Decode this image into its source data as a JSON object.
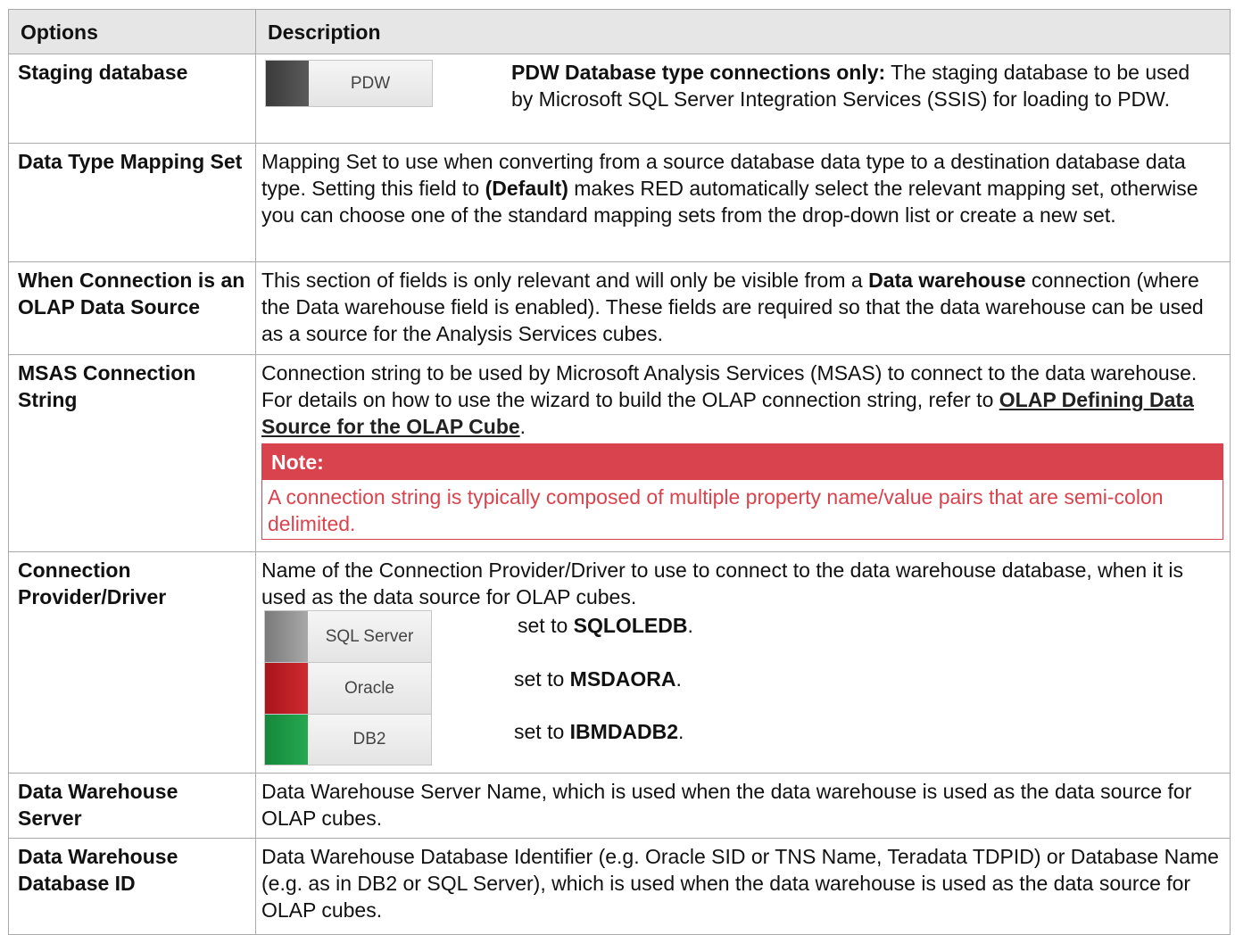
{
  "header": {
    "options": "Options",
    "description": "Description"
  },
  "rows": {
    "staging": {
      "option": "Staging database",
      "button_label": "PDW",
      "lead_bold": "PDW Database type connections only:",
      "text": " The staging database to be used by Microsoft SQL Server Integration Services (SSIS) for loading to PDW."
    },
    "mapping": {
      "option": "Data Type Mapping Set",
      "t1": " Mapping Set to use when converting from a source database data type to a destination database data type. Setting this field to ",
      "bold": "(Default)",
      "t2": " makes RED automatically select the relevant mapping set, otherwise you can choose one of the standard mapping sets from the drop-down list or create a new set."
    },
    "olap": {
      "option": "When Connection is an OLAP Data Source",
      "t1": " This section of fields is only relevant and will only be visible from a ",
      "bold": "Data warehouse",
      "t2": " connection (where the Data warehouse field is enabled). These fields are required so that the data warehouse can be used as a source for the Analysis Services cubes."
    },
    "msas": {
      "option": "MSAS Connection String",
      "t1": " Connection string to be used by Microsoft Analysis Services (MSAS) to connect to the data warehouse. For details on how to use the wizard to build the OLAP connection string, refer to ",
      "link": "OLAP Defining Data Source for the OLAP Cube",
      "t2": ".",
      "note_title": "Note:",
      "note_text": " A connection string is typically composed of multiple property name/value pairs that are semi-colon delimited."
    },
    "provider": {
      "option": "Connection Provider/Driver",
      "text": " Name of the Connection Provider/Driver to use to connect to the data warehouse database, when it is used as the data source for OLAP cubes.",
      "drivers": [
        {
          "label": "SQL Server",
          "prefix": "set to ",
          "value": "SQLOLEDB",
          "suffix": "."
        },
        {
          "label": "Oracle",
          "prefix": "set to ",
          "value": "MSDAORA",
          "suffix": "."
        },
        {
          "label": "DB2",
          "prefix": "set to ",
          "value": "IBMDADB2",
          "suffix": "."
        }
      ]
    },
    "dwserver": {
      "option": "Data Warehouse Server",
      "text": " Data Warehouse Server Name, which is used when the data warehouse is used as the data source for OLAP cubes."
    },
    "dwdbid": {
      "option": "Data Warehouse Database ID",
      "text": " Data Warehouse Database Identifier (e.g. Oracle SID or TNS Name, Teradata TDPID) or Database Name (e.g. as in DB2 or SQL Server), which is used when the data warehouse is used as the data source for OLAP cubes."
    }
  },
  "colors": {
    "pdw": "#4a4a4a",
    "sqlserver": "#8c8c8c",
    "oracle": "#c01d25",
    "db2": "#1d9a45",
    "note": "#d9434d"
  }
}
